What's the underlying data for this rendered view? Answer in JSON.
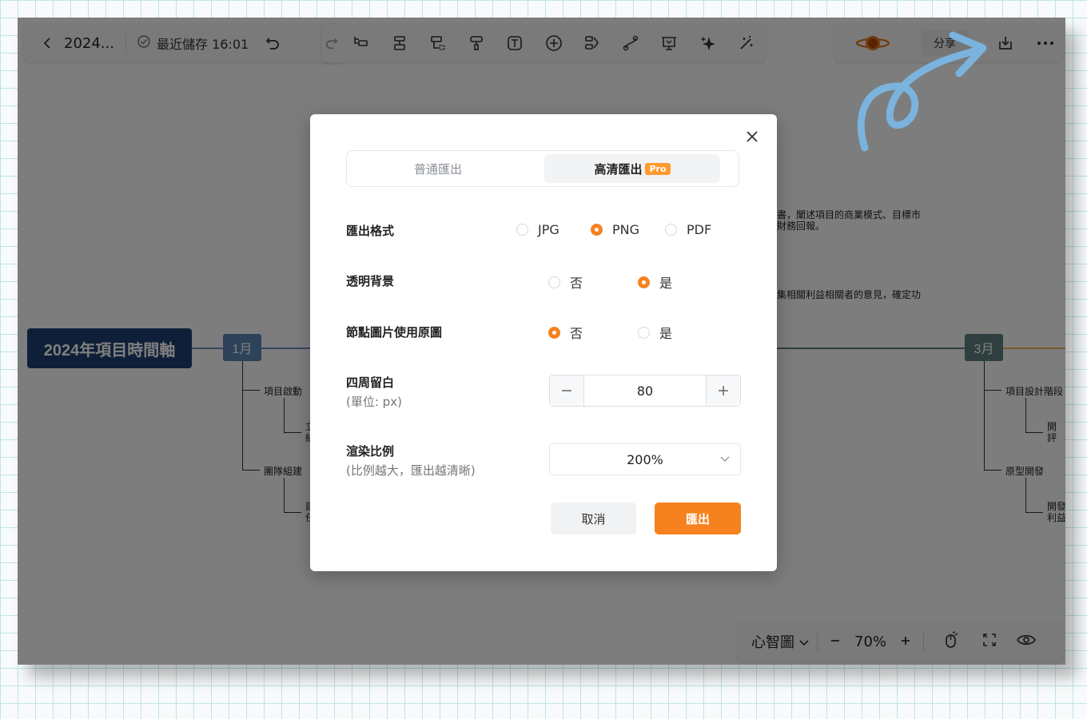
{
  "toolbar": {
    "doc_title": "2024...",
    "save_status": "最近儲存 16:01",
    "share_label": "分享"
  },
  "mindmap": {
    "root": "2024年項目時間軸",
    "month1": "1月",
    "month3": "3月",
    "m1_children": [
      "項目啟動",
      "團隊組建"
    ],
    "m1_grandchildren": [
      "立\n組",
      "建\n任"
    ],
    "m3_children": [
      "項目設計階段",
      "原型開發"
    ],
    "m3_grandchildren": [
      "開\n評",
      "開發\n利益"
    ],
    "desc1": "書，闡述項目的商業模式、目標市\n財務回報。",
    "desc2": "集相關利益相關者的意見，確定功"
  },
  "bottom_bar": {
    "mode": "心智圖",
    "zoom": "70%"
  },
  "dialog": {
    "tabs": {
      "normal": "普通匯出",
      "hd": "高清匯出",
      "pro_badge": "Pro"
    },
    "format_label": "匯出格式",
    "formats": [
      "JPG",
      "PNG",
      "PDF"
    ],
    "selected_format": "PNG",
    "transparent_label": "透明背景",
    "transparent_options": [
      "否",
      "是"
    ],
    "transparent_selected": "是",
    "original_image_label": "節點圖片使用原圖",
    "original_image_options": [
      "否",
      "是"
    ],
    "original_image_selected": "否",
    "padding_label": "四周留白",
    "padding_unit": "(單位: px)",
    "padding_value": "80",
    "scale_label": "渲染比例",
    "scale_hint": "(比例越大，匯出越清晰)",
    "scale_value": "200%",
    "cancel": "取消",
    "export": "匯出"
  },
  "colors": {
    "accent": "#f6821f",
    "root_node": "#1f3f73",
    "month1_node": "#5c84b3",
    "month3_node": "#5e7d7e",
    "annotation_arrow": "#7ab3dd"
  }
}
